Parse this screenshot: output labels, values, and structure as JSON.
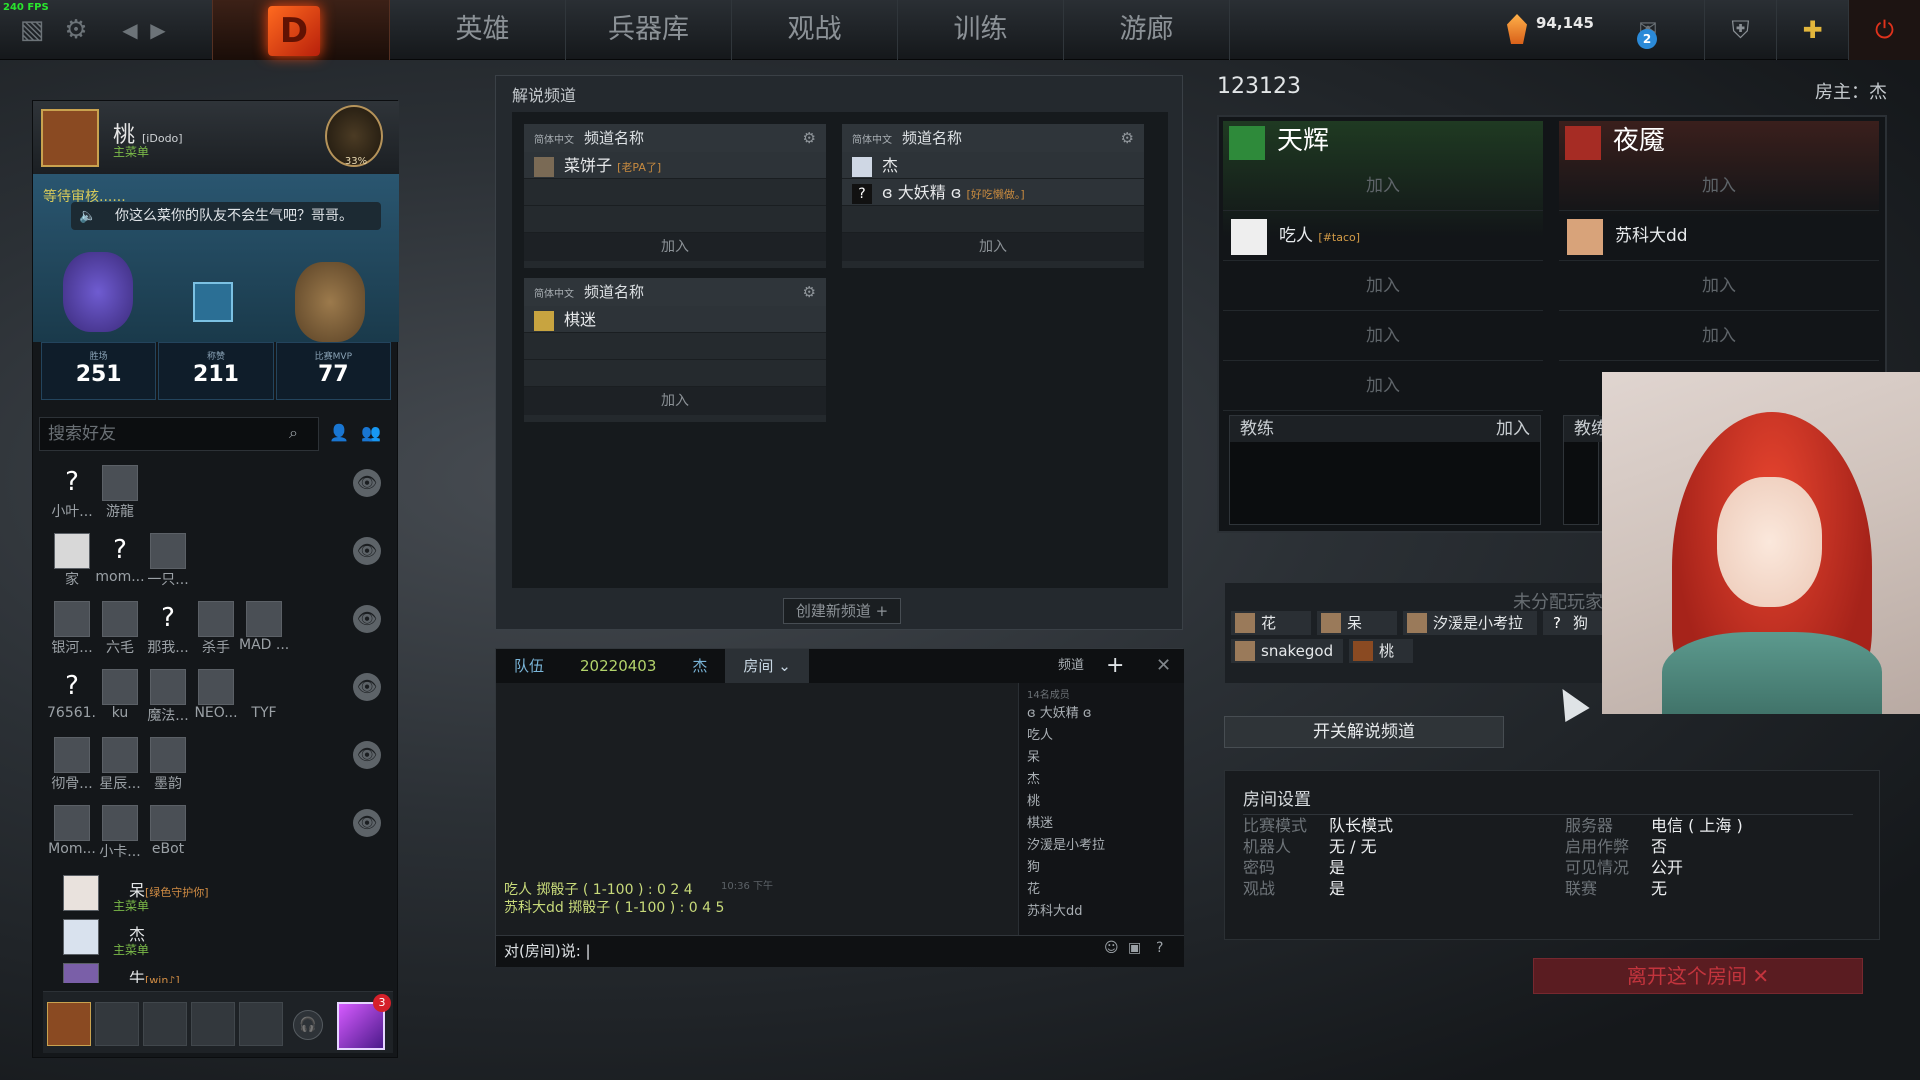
{
  "fps": "240 FPS",
  "topbar": {
    "nav": [
      "英雄",
      "兵器库",
      "观战",
      "训练",
      "游廊"
    ],
    "shards": "94,145",
    "mail_count": "2"
  },
  "profile": {
    "name": "桃",
    "tag": "[iDodo]",
    "status": "主菜单",
    "rank_pct": "33%"
  },
  "lobby": {
    "waiting": "等待审核......",
    "message": "你这么菜你的队友不会生气吧？哥哥。",
    "stats": [
      {
        "label": "胜场",
        "value": "251"
      },
      {
        "label": "称赞",
        "value": "211"
      },
      {
        "label": "比赛MVP",
        "value": "77"
      }
    ]
  },
  "friends": {
    "search_placeholder": "搜索好友",
    "grid": [
      [
        "小叶...",
        "游龍"
      ],
      [
        "家",
        "mom...",
        "一只..."
      ],
      [
        "银河...",
        "六毛",
        "那我...",
        "杀手",
        "MAD ..."
      ],
      [
        "76561...",
        "ku",
        "魔法...",
        "NEO...",
        "TYF"
      ],
      [
        "彻骨...",
        "星辰...",
        "墨韵"
      ],
      [
        "Mom...",
        "小卡...",
        "eBot"
      ]
    ],
    "list": [
      {
        "name": "呆",
        "tag": "[绿色守护你]",
        "status": "主菜单"
      },
      {
        "name": "杰",
        "tag": "",
        "status": "主菜单"
      },
      {
        "name": "牛",
        "tag": "[win♪]",
        "status": ""
      }
    ],
    "notif_count": "3"
  },
  "broadcast": {
    "title": "解说频道",
    "lang": "简体中文",
    "channel_name": "频道名称",
    "channels": [
      {
        "members": [
          {
            "name": "菜饼子",
            "tag": "[老PA了]"
          }
        ]
      },
      {
        "members": [
          {
            "name": "杰",
            "tag": ""
          },
          {
            "name": "ɞ 大妖精 ɞ",
            "tag": "[好吃懒做。]"
          }
        ]
      },
      {
        "members": [
          {
            "name": "棋迷",
            "tag": ""
          }
        ]
      }
    ],
    "join": "加入",
    "create": "创建新频道 +"
  },
  "chat": {
    "tabs": [
      "队伍",
      "20220403",
      "杰",
      "房间"
    ],
    "channel_label": "频道",
    "timestamp": "10:36 下午",
    "log": [
      "吃人 掷骰子 ( 1-100 ) :  0 2 4",
      "苏科大dd 掷骰子 ( 1-100 ) :  0 4 5"
    ],
    "members_header": "14名成员",
    "members": [
      "ɞ 大妖精 ɞ",
      "吃人",
      "呆",
      "杰",
      "桃",
      "棋迷",
      "汐湲是小考拉",
      "狗",
      "花",
      "苏科大dd"
    ],
    "input_prefix": "对(房间)说:"
  },
  "room": {
    "id": "123123",
    "host": "房主：杰",
    "radiant": "天辉",
    "dire": "夜魇",
    "join": "加入",
    "coach": "教练",
    "radiant_player": {
      "name": "吃人",
      "tag": "[#taco]"
    },
    "dire_player": {
      "name": "苏科大dd"
    },
    "unassigned_title": "未分配玩家",
    "unassigned": [
      "花",
      "呆",
      "汐湲是小考拉",
      "狗",
      "snakegod",
      "桃"
    ],
    "toggle_broadcast": "开关解说频道",
    "settings_title": "房间设置",
    "settings": [
      {
        "k": "比赛模式",
        "v": "队长模式"
      },
      {
        "k": "机器人",
        "v": "无 / 无"
      },
      {
        "k": "密码",
        "v": "是"
      },
      {
        "k": "观战",
        "v": "是"
      },
      {
        "k": "服务器",
        "v": "电信 ( 上海 )"
      },
      {
        "k": "启用作弊",
        "v": "否"
      },
      {
        "k": "可见情况",
        "v": "公开"
      },
      {
        "k": "联赛",
        "v": "无"
      }
    ],
    "leave": "离开这个房间"
  },
  "colors": {
    "accent_green": "#7ab948",
    "radiant": "#62d36b",
    "dire": "#d9453b"
  }
}
